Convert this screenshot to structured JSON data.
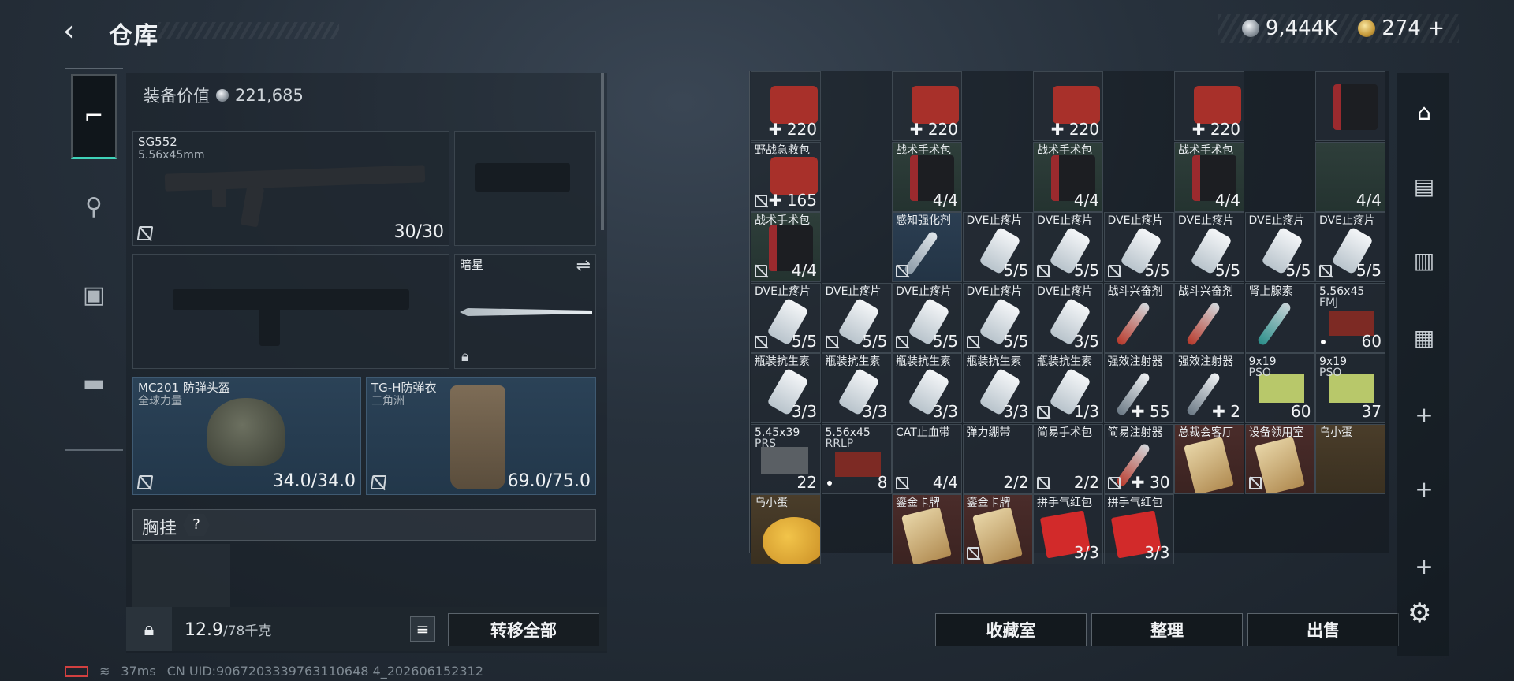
{
  "header": {
    "back_icon": "‹",
    "title": "仓库"
  },
  "currency": [
    {
      "icon": "silver-coin",
      "value": "9,444K"
    },
    {
      "icon": "gold-coin",
      "value": "274 +"
    }
  ],
  "sidebar": {
    "tabs": [
      {
        "icon": "pistol-icon",
        "glyph": "⌐",
        "active": true
      },
      {
        "icon": "backpack-icon",
        "glyph": "⚲"
      },
      {
        "icon": "vest-icon",
        "glyph": "▣"
      },
      {
        "icon": "toolbox-icon",
        "glyph": "▬"
      }
    ]
  },
  "equip": {
    "value_label": "装备价值",
    "value": "221,685",
    "primary": {
      "name": "SG552",
      "ammo": "5.56x45mm",
      "qty": "30/30"
    },
    "melee": {
      "name": "暗星"
    },
    "helmet": {
      "name": "MC201 防弹头盔",
      "sub": "全球力量",
      "qty": "34.0/34.0"
    },
    "armor": {
      "name": "TG-H防弹衣",
      "sub": "三角洲",
      "qty": "69.0/75.0"
    },
    "rig": {
      "label": "胸挂",
      "help": "?"
    }
  },
  "bottom_left": {
    "weight": "12.9",
    "weight_max": "/78千克",
    "list_icon": "≡",
    "transfer_label": "转移全部"
  },
  "status": {
    "ping": "37ms",
    "uid": "CN UID:9067203339763110648 4_202606152312"
  },
  "storage": {
    "cells": [
      {
        "r": 0,
        "c": 0,
        "name": "",
        "q": "✚ 220",
        "ico": "kit-red"
      },
      {
        "r": 0,
        "c": 2,
        "name": "",
        "q": "✚ 220",
        "ico": "kit-red"
      },
      {
        "r": 0,
        "c": 4,
        "name": "",
        "q": "✚ 220",
        "ico": "kit-red"
      },
      {
        "r": 0,
        "c": 6,
        "name": "",
        "q": "✚ 220",
        "ico": "kit-red"
      },
      {
        "r": 0,
        "c": 8,
        "name": "",
        "q": "",
        "ico": "kit-black"
      },
      {
        "r": 1,
        "c": 0,
        "name": "野战急救包",
        "q": "✚ 165",
        "ico": "kit-red",
        "ni": true
      },
      {
        "r": 1,
        "c": 2,
        "name": "战术手术包",
        "q": "4/4",
        "ico": "kit-black",
        "bg": "bg-green"
      },
      {
        "r": 1,
        "c": 4,
        "name": "战术手术包",
        "q": "4/4",
        "ico": "kit-black",
        "bg": "bg-green"
      },
      {
        "r": 1,
        "c": 6,
        "name": "战术手术包",
        "q": "4/4",
        "ico": "kit-black",
        "bg": "bg-green"
      },
      {
        "r": 1,
        "c": 8,
        "name": "",
        "q": "4/4",
        "ico": "",
        "bg": "bg-green"
      },
      {
        "r": 2,
        "c": 0,
        "name": "战术手术包",
        "q": "4/4",
        "ico": "kit-black",
        "bg": "bg-green",
        "ni": true
      },
      {
        "r": 2,
        "c": 2,
        "name": "感知强化剂",
        "q": "",
        "ico": "pen",
        "bg": "bg-blue",
        "ni": true
      },
      {
        "r": 2,
        "c": 3,
        "name": "DVE止疼片",
        "q": "5/5",
        "ico": "bottle"
      },
      {
        "r": 2,
        "c": 4,
        "name": "DVE止疼片",
        "q": "5/5",
        "ico": "bottle",
        "ni": true
      },
      {
        "r": 2,
        "c": 5,
        "name": "DVE止疼片",
        "q": "5/5",
        "ico": "bottle",
        "ni": true
      },
      {
        "r": 2,
        "c": 6,
        "name": "DVE止疼片",
        "q": "5/5",
        "ico": "bottle"
      },
      {
        "r": 2,
        "c": 7,
        "name": "DVE止疼片",
        "q": "5/5",
        "ico": "bottle"
      },
      {
        "r": 2,
        "c": 8,
        "name": "DVE止疼片",
        "q": "5/5",
        "ico": "bottle",
        "ni": true
      },
      {
        "r": 3,
        "c": 0,
        "name": "DVE止疼片",
        "q": "5/5",
        "ico": "bottle",
        "ni": true
      },
      {
        "r": 3,
        "c": 1,
        "name": "DVE止疼片",
        "q": "5/5",
        "ico": "bottle",
        "ni": true
      },
      {
        "r": 3,
        "c": 2,
        "name": "DVE止疼片",
        "q": "5/5",
        "ico": "bottle",
        "ni": true
      },
      {
        "r": 3,
        "c": 3,
        "name": "DVE止疼片",
        "q": "5/5",
        "ico": "bottle",
        "ni": true
      },
      {
        "r": 3,
        "c": 4,
        "name": "DVE止疼片",
        "q": "3/5",
        "ico": "bottle"
      },
      {
        "r": 3,
        "c": 5,
        "name": "战斗兴奋剂",
        "q": "",
        "ico": "pen red"
      },
      {
        "r": 3,
        "c": 6,
        "name": "战斗兴奋剂",
        "q": "",
        "ico": "pen red"
      },
      {
        "r": 3,
        "c": 7,
        "name": "肾上腺素",
        "q": "",
        "ico": "pen teal"
      },
      {
        "r": 3,
        "c": 8,
        "name": "5.56x45",
        "name2": "FMJ",
        "q": "60",
        "ico": "ammo-red",
        "dot": true
      },
      {
        "r": 4,
        "c": 0,
        "name": "瓶装抗生素",
        "q": "3/3",
        "ico": "bottle"
      },
      {
        "r": 4,
        "c": 1,
        "name": "瓶装抗生素",
        "q": "3/3",
        "ico": "bottle"
      },
      {
        "r": 4,
        "c": 2,
        "name": "瓶装抗生素",
        "q": "3/3",
        "ico": "bottle"
      },
      {
        "r": 4,
        "c": 3,
        "name": "瓶装抗生素",
        "q": "3/3",
        "ico": "bottle"
      },
      {
        "r": 4,
        "c": 4,
        "name": "瓶装抗生素",
        "q": "1/3",
        "ico": "bottle",
        "ni": true
      },
      {
        "r": 4,
        "c": 5,
        "name": "强效注射器",
        "q": "✚ 55",
        "ico": "pen white"
      },
      {
        "r": 4,
        "c": 6,
        "name": "强效注射器",
        "q": "✚ 2",
        "ico": "pen white"
      },
      {
        "r": 4,
        "c": 7,
        "name": "9x19",
        "name2": "PSO",
        "q": "60",
        "ico": "ammo-green"
      },
      {
        "r": 4,
        "c": 8,
        "name": "9x19",
        "name2": "PSO",
        "q": "37",
        "ico": "ammo-green"
      },
      {
        "r": 5,
        "c": 0,
        "name": "5.45x39",
        "name2": "PRS",
        "q": "22",
        "ico": "ammo-gray"
      },
      {
        "r": 5,
        "c": 1,
        "name": "5.56x45",
        "name2": "RRLP",
        "q": "8",
        "ico": "ammo-red",
        "dot": true
      },
      {
        "r": 5,
        "c": 2,
        "name": "CAT止血带",
        "q": "4/4",
        "ico": "",
        "ni": true
      },
      {
        "r": 5,
        "c": 3,
        "name": "弹力绷带",
        "q": "2/2",
        "ico": ""
      },
      {
        "r": 5,
        "c": 4,
        "name": "简易手术包",
        "q": "2/2",
        "ico": "",
        "ni": true
      },
      {
        "r": 5,
        "c": 5,
        "name": "简易注射器",
        "q": "✚ 30",
        "ico": "pen red",
        "ni": true
      },
      {
        "r": 5,
        "c": 6,
        "name": "总裁会客厅",
        "q": "",
        "ico": "card",
        "bg": "bg-red"
      },
      {
        "r": 5,
        "c": 7,
        "name": "设备领用室",
        "q": "",
        "ico": "card",
        "bg": "bg-red",
        "ni": true
      },
      {
        "r": 5,
        "c": 8,
        "name": "乌小蛋",
        "q": "",
        "ico": "",
        "bg": "bg-gold"
      },
      {
        "r": 6,
        "c": 0,
        "name": "乌小蛋",
        "q": "",
        "ico": "egg",
        "bg": "bg-gold"
      },
      {
        "r": 6,
        "c": 2,
        "name": "鎏金卡牌",
        "q": "",
        "ico": "card",
        "bg": "bg-red"
      },
      {
        "r": 6,
        "c": 3,
        "name": "鎏金卡牌",
        "q": "",
        "ico": "card",
        "bg": "bg-red",
        "ni": true
      },
      {
        "r": 6,
        "c": 4,
        "name": "拼手气红包",
        "q": "3/3",
        "ico": "envelope"
      },
      {
        "r": 6,
        "c": 5,
        "name": "拼手气红包",
        "q": "3/3",
        "ico": "envelope"
      }
    ]
  },
  "buttons": {
    "collect": "收藏室",
    "sort": "整理",
    "sell": "出售"
  },
  "rail": [
    {
      "icon": "storage-icon",
      "glyph": "⌂",
      "active": true
    },
    {
      "icon": "case-iv-icon",
      "glyph": "▤"
    },
    {
      "icon": "case-ii-icon",
      "glyph": "▥"
    },
    {
      "icon": "case-iii-icon",
      "glyph": "▦"
    },
    {
      "icon": "add-icon",
      "glyph": "+"
    },
    {
      "icon": "add-icon",
      "glyph": "+"
    },
    {
      "icon": "add-icon",
      "glyph": "+"
    }
  ],
  "gear_icon": "⚙"
}
